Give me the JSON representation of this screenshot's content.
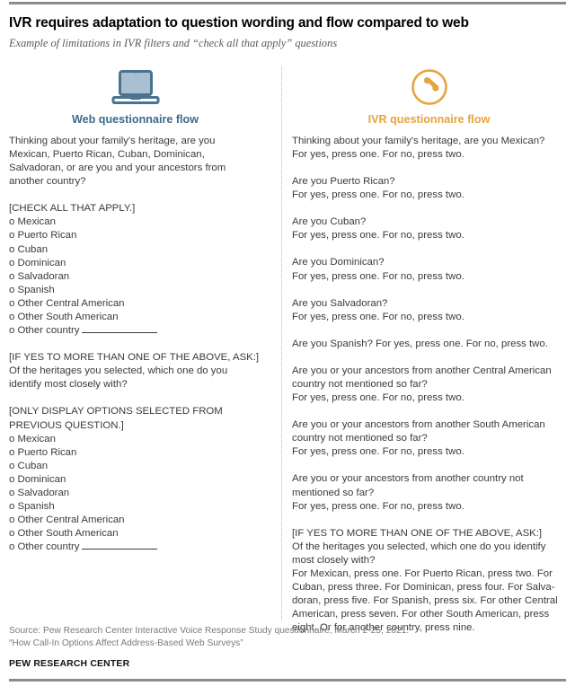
{
  "header": {
    "title": "IVR requires adaptation to question wording and flow compared to web",
    "subtitle": "Example of limitations in IVR filters and “check all that apply” questions"
  },
  "colors": {
    "web_accent": "#3d6a8a",
    "ivr_accent": "#e8a33d",
    "rule": "#8c8c8c",
    "body_text": "#3b3b3b",
    "source_text": "#7a7a7a"
  },
  "web_column": {
    "icon": "laptop-icon",
    "heading": "Web questionnaire flow",
    "blocks": [
      {
        "type": "paragraph",
        "lines": [
          "Thinking about your family's heritage, are you",
          "Mexican, Puerto Rican, Cuban, Dominican,",
          "Salvadoran, or are you and your ancestors from",
          "another country?"
        ]
      },
      {
        "type": "option-list",
        "instruction": "[CHECK ALL THAT APPLY.]",
        "options": [
          "o Mexican",
          "o Puerto Rican",
          "o Cuban",
          "o Dominican",
          "o Salvadoran",
          "o Spanish",
          "o Other Central American",
          "o Other South American"
        ],
        "last_option_label": "o Other country",
        "last_option_has_blank": true
      },
      {
        "type": "paragraph",
        "lines": [
          "[IF YES TO MORE THAN ONE OF THE ABOVE, ASK:]",
          "Of the heritages you selected, which one do you",
          "identify most closely with?"
        ]
      },
      {
        "type": "option-list",
        "instruction": "[ONLY DISPLAY OPTIONS SELECTED FROM\nPREVIOUS QUESTION.]",
        "options": [
          "o Mexican",
          "o Puerto Rican",
          "o Cuban",
          "o Dominican",
          "o Salvadoran",
          "o Spanish",
          "o Other Central American",
          "o Other South American"
        ],
        "last_option_label": "o Other country",
        "last_option_has_blank": true
      }
    ]
  },
  "ivr_column": {
    "icon": "phone-handset-icon",
    "heading": "IVR questionnaire flow",
    "blocks": [
      {
        "lines": [
          "Thinking about your family's heritage, are you Mexican?",
          "For yes, press one. For no, press two."
        ]
      },
      {
        "lines": [
          "Are you Puerto Rican?",
          "For yes, press one. For no, press two."
        ]
      },
      {
        "lines": [
          "Are you Cuban?",
          "For yes, press one. For no, press two."
        ]
      },
      {
        "lines": [
          "Are you Dominican?",
          "For yes, press one. For no, press two."
        ]
      },
      {
        "lines": [
          "Are you Salvadoran?",
          "For yes, press one. For no, press two."
        ]
      },
      {
        "lines": [
          "Are you Spanish? For yes, press one. For no, press two."
        ]
      },
      {
        "lines": [
          "Are you or your ancestors from another Central American",
          "country not mentioned so far?",
          "For yes, press one. For no, press two."
        ]
      },
      {
        "lines": [
          "Are you or your ancestors from another South American",
          "country not mentioned so far?",
          "For yes, press one. For no, press two."
        ]
      },
      {
        "lines": [
          "Are you or your ancestors from another country not",
          "mentioned so far?",
          "For yes, press one. For no, press two."
        ]
      },
      {
        "lines": [
          "[IF YES TO MORE THAN ONE OF THE ABOVE, ASK:]",
          "Of the heritages you selected, which one do you identify",
          "most closely with?",
          "For Mexican, press one. For Puerto Rican, press two. For",
          "Cuban, press three. For Dominican, press four. For Salva-",
          "doran, press five. For Spanish, press six. For other Central",
          "American, press seven. For other South American, press",
          "eight. Or for another country, press nine."
        ]
      }
    ]
  },
  "footer": {
    "source_line_1": "Source: Pew Research Center Interactive Voice Response Study questionnaire, March 2-25, 2021.",
    "source_line_2": "“How Call-In Options Affect Address-Based Web Surveys”",
    "organization": "PEW RESEARCH CENTER"
  }
}
